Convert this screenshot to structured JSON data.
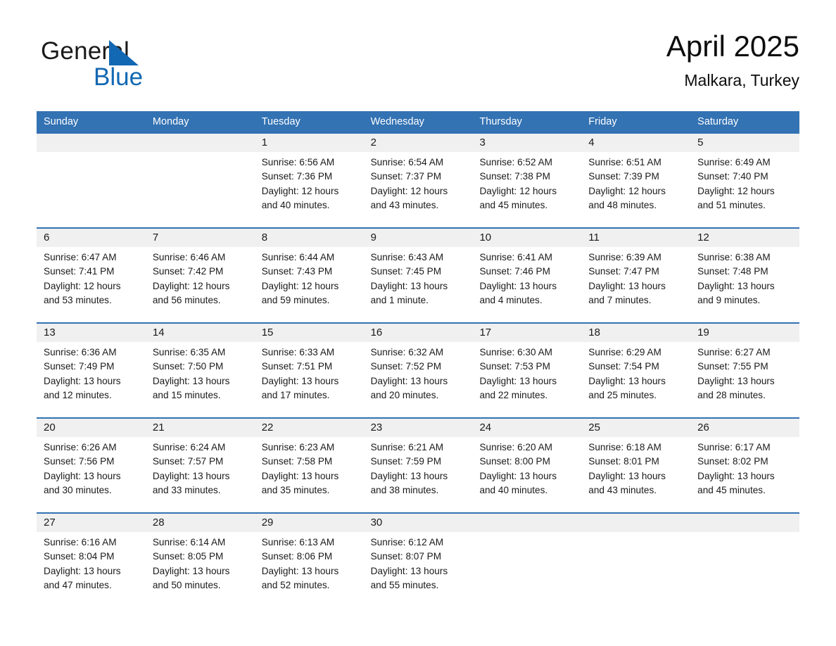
{
  "brand": {
    "word_general": "General",
    "word_blue": "Blue",
    "triangle_color": "#1268b3",
    "text_color": "#1a1a1a"
  },
  "header": {
    "title": "April 2025",
    "subtitle": "Malkara, Turkey"
  },
  "theme": {
    "header_blue": "#3372b3",
    "row_divider_blue": "#3372b3",
    "date_band_gray": "#f0f0f0",
    "cell_white": "#ffffff",
    "text": "#1a1a1a"
  },
  "weekdays": [
    "Sunday",
    "Monday",
    "Tuesday",
    "Wednesday",
    "Thursday",
    "Friday",
    "Saturday"
  ],
  "weeks": [
    {
      "days": [
        {
          "num": "",
          "sunrise": "",
          "sunset": "",
          "daylight1": "",
          "daylight2": ""
        },
        {
          "num": "",
          "sunrise": "",
          "sunset": "",
          "daylight1": "",
          "daylight2": ""
        },
        {
          "num": "1",
          "sunrise": "Sunrise: 6:56 AM",
          "sunset": "Sunset: 7:36 PM",
          "daylight1": "Daylight: 12 hours",
          "daylight2": "and 40 minutes."
        },
        {
          "num": "2",
          "sunrise": "Sunrise: 6:54 AM",
          "sunset": "Sunset: 7:37 PM",
          "daylight1": "Daylight: 12 hours",
          "daylight2": "and 43 minutes."
        },
        {
          "num": "3",
          "sunrise": "Sunrise: 6:52 AM",
          "sunset": "Sunset: 7:38 PM",
          "daylight1": "Daylight: 12 hours",
          "daylight2": "and 45 minutes."
        },
        {
          "num": "4",
          "sunrise": "Sunrise: 6:51 AM",
          "sunset": "Sunset: 7:39 PM",
          "daylight1": "Daylight: 12 hours",
          "daylight2": "and 48 minutes."
        },
        {
          "num": "5",
          "sunrise": "Sunrise: 6:49 AM",
          "sunset": "Sunset: 7:40 PM",
          "daylight1": "Daylight: 12 hours",
          "daylight2": "and 51 minutes."
        }
      ]
    },
    {
      "days": [
        {
          "num": "6",
          "sunrise": "Sunrise: 6:47 AM",
          "sunset": "Sunset: 7:41 PM",
          "daylight1": "Daylight: 12 hours",
          "daylight2": "and 53 minutes."
        },
        {
          "num": "7",
          "sunrise": "Sunrise: 6:46 AM",
          "sunset": "Sunset: 7:42 PM",
          "daylight1": "Daylight: 12 hours",
          "daylight2": "and 56 minutes."
        },
        {
          "num": "8",
          "sunrise": "Sunrise: 6:44 AM",
          "sunset": "Sunset: 7:43 PM",
          "daylight1": "Daylight: 12 hours",
          "daylight2": "and 59 minutes."
        },
        {
          "num": "9",
          "sunrise": "Sunrise: 6:43 AM",
          "sunset": "Sunset: 7:45 PM",
          "daylight1": "Daylight: 13 hours",
          "daylight2": "and 1 minute."
        },
        {
          "num": "10",
          "sunrise": "Sunrise: 6:41 AM",
          "sunset": "Sunset: 7:46 PM",
          "daylight1": "Daylight: 13 hours",
          "daylight2": "and 4 minutes."
        },
        {
          "num": "11",
          "sunrise": "Sunrise: 6:39 AM",
          "sunset": "Sunset: 7:47 PM",
          "daylight1": "Daylight: 13 hours",
          "daylight2": "and 7 minutes."
        },
        {
          "num": "12",
          "sunrise": "Sunrise: 6:38 AM",
          "sunset": "Sunset: 7:48 PM",
          "daylight1": "Daylight: 13 hours",
          "daylight2": "and 9 minutes."
        }
      ]
    },
    {
      "days": [
        {
          "num": "13",
          "sunrise": "Sunrise: 6:36 AM",
          "sunset": "Sunset: 7:49 PM",
          "daylight1": "Daylight: 13 hours",
          "daylight2": "and 12 minutes."
        },
        {
          "num": "14",
          "sunrise": "Sunrise: 6:35 AM",
          "sunset": "Sunset: 7:50 PM",
          "daylight1": "Daylight: 13 hours",
          "daylight2": "and 15 minutes."
        },
        {
          "num": "15",
          "sunrise": "Sunrise: 6:33 AM",
          "sunset": "Sunset: 7:51 PM",
          "daylight1": "Daylight: 13 hours",
          "daylight2": "and 17 minutes."
        },
        {
          "num": "16",
          "sunrise": "Sunrise: 6:32 AM",
          "sunset": "Sunset: 7:52 PM",
          "daylight1": "Daylight: 13 hours",
          "daylight2": "and 20 minutes."
        },
        {
          "num": "17",
          "sunrise": "Sunrise: 6:30 AM",
          "sunset": "Sunset: 7:53 PM",
          "daylight1": "Daylight: 13 hours",
          "daylight2": "and 22 minutes."
        },
        {
          "num": "18",
          "sunrise": "Sunrise: 6:29 AM",
          "sunset": "Sunset: 7:54 PM",
          "daylight1": "Daylight: 13 hours",
          "daylight2": "and 25 minutes."
        },
        {
          "num": "19",
          "sunrise": "Sunrise: 6:27 AM",
          "sunset": "Sunset: 7:55 PM",
          "daylight1": "Daylight: 13 hours",
          "daylight2": "and 28 minutes."
        }
      ]
    },
    {
      "days": [
        {
          "num": "20",
          "sunrise": "Sunrise: 6:26 AM",
          "sunset": "Sunset: 7:56 PM",
          "daylight1": "Daylight: 13 hours",
          "daylight2": "and 30 minutes."
        },
        {
          "num": "21",
          "sunrise": "Sunrise: 6:24 AM",
          "sunset": "Sunset: 7:57 PM",
          "daylight1": "Daylight: 13 hours",
          "daylight2": "and 33 minutes."
        },
        {
          "num": "22",
          "sunrise": "Sunrise: 6:23 AM",
          "sunset": "Sunset: 7:58 PM",
          "daylight1": "Daylight: 13 hours",
          "daylight2": "and 35 minutes."
        },
        {
          "num": "23",
          "sunrise": "Sunrise: 6:21 AM",
          "sunset": "Sunset: 7:59 PM",
          "daylight1": "Daylight: 13 hours",
          "daylight2": "and 38 minutes."
        },
        {
          "num": "24",
          "sunrise": "Sunrise: 6:20 AM",
          "sunset": "Sunset: 8:00 PM",
          "daylight1": "Daylight: 13 hours",
          "daylight2": "and 40 minutes."
        },
        {
          "num": "25",
          "sunrise": "Sunrise: 6:18 AM",
          "sunset": "Sunset: 8:01 PM",
          "daylight1": "Daylight: 13 hours",
          "daylight2": "and 43 minutes."
        },
        {
          "num": "26",
          "sunrise": "Sunrise: 6:17 AM",
          "sunset": "Sunset: 8:02 PM",
          "daylight1": "Daylight: 13 hours",
          "daylight2": "and 45 minutes."
        }
      ]
    },
    {
      "days": [
        {
          "num": "27",
          "sunrise": "Sunrise: 6:16 AM",
          "sunset": "Sunset: 8:04 PM",
          "daylight1": "Daylight: 13 hours",
          "daylight2": "and 47 minutes."
        },
        {
          "num": "28",
          "sunrise": "Sunrise: 6:14 AM",
          "sunset": "Sunset: 8:05 PM",
          "daylight1": "Daylight: 13 hours",
          "daylight2": "and 50 minutes."
        },
        {
          "num": "29",
          "sunrise": "Sunrise: 6:13 AM",
          "sunset": "Sunset: 8:06 PM",
          "daylight1": "Daylight: 13 hours",
          "daylight2": "and 52 minutes."
        },
        {
          "num": "30",
          "sunrise": "Sunrise: 6:12 AM",
          "sunset": "Sunset: 8:07 PM",
          "daylight1": "Daylight: 13 hours",
          "daylight2": "and 55 minutes."
        },
        {
          "num": "",
          "sunrise": "",
          "sunset": "",
          "daylight1": "",
          "daylight2": ""
        },
        {
          "num": "",
          "sunrise": "",
          "sunset": "",
          "daylight1": "",
          "daylight2": ""
        },
        {
          "num": "",
          "sunrise": "",
          "sunset": "",
          "daylight1": "",
          "daylight2": ""
        }
      ]
    }
  ]
}
